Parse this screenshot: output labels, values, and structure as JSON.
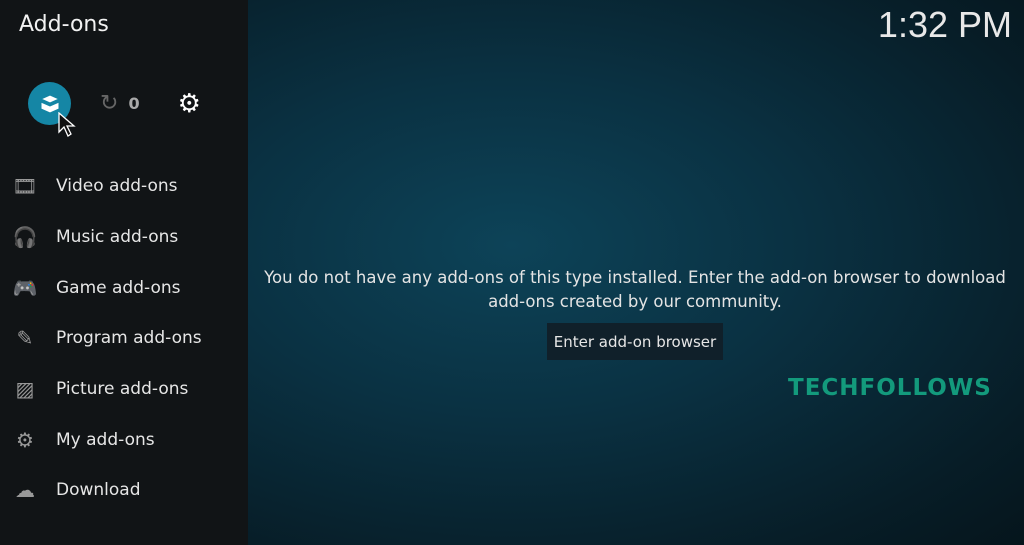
{
  "header": {
    "title": "Add-ons",
    "clock": "1:32 PM"
  },
  "toolbar": {
    "update_count": "0",
    "icons": [
      "addon-browser-box-icon",
      "refresh-icon",
      "gear-icon"
    ]
  },
  "sidebar": {
    "items": [
      {
        "label": "Video add-ons",
        "icon": "film-icon"
      },
      {
        "label": "Music add-ons",
        "icon": "headphones-icon"
      },
      {
        "label": "Game add-ons",
        "icon": "gamepad-icon"
      },
      {
        "label": "Program add-ons",
        "icon": "tools-icon"
      },
      {
        "label": "Picture add-ons",
        "icon": "picture-icon"
      },
      {
        "label": "My add-ons",
        "icon": "gears-icon"
      },
      {
        "label": "Download",
        "icon": "cloud-download-icon"
      }
    ]
  },
  "main": {
    "message": "You do not have any add-ons of this type installed. Enter the add-on browser to download add-ons created by our community.",
    "button": "Enter add-on browser"
  },
  "watermark": "TECHFOLLOWS",
  "colors": {
    "accent": "#1586a5",
    "watermark": "#139a7c"
  }
}
